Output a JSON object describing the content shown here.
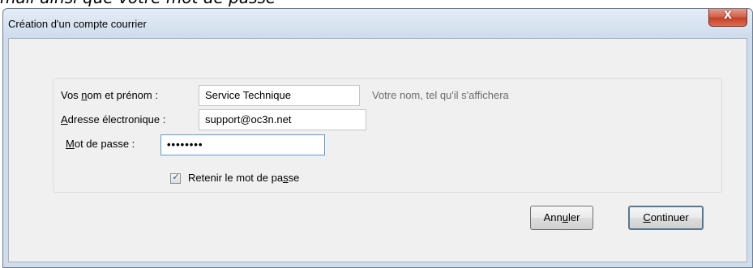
{
  "caption": "mail ainsi que votre mot de passe",
  "window": {
    "title": "Création d'un compte courrier",
    "close_glyph": "X"
  },
  "form": {
    "name_label_pre": "Vos ",
    "name_label_acc": "n",
    "name_label_post": "om et prénom :",
    "name_value": "Service Technique",
    "name_hint": "Votre nom, tel qu'il s'affichera",
    "email_label_acc": "A",
    "email_label_post": "dresse électronique :",
    "email_value": "support@oc3n.net",
    "password_label_acc": "M",
    "password_label_post": "ot de passe :",
    "password_value": "••••••••",
    "remember_label_pre": "Retenir le mot de pa",
    "remember_label_acc": "s",
    "remember_label_post": "se",
    "remember_checked": true
  },
  "buttons": {
    "cancel_pre": "Ann",
    "cancel_acc": "u",
    "cancel_post": "ler",
    "continue_acc": "C",
    "continue_post": "ontinuer"
  }
}
